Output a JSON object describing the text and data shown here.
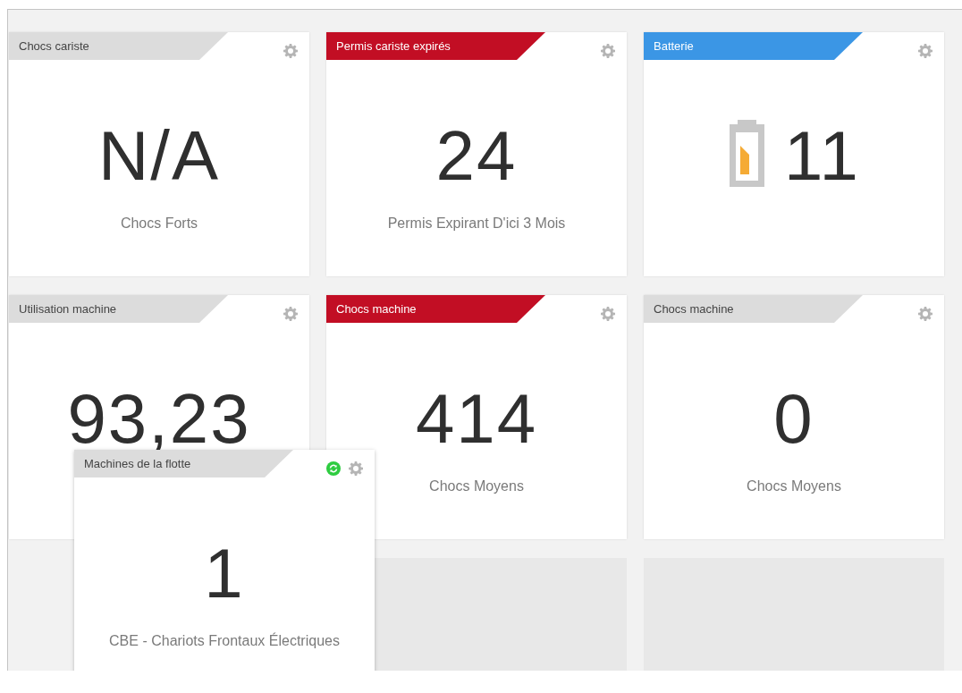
{
  "tiles": [
    {
      "kind": "stat",
      "title": "Chocs cariste",
      "color": "#dcdcdc",
      "value": "N/A",
      "caption": "Chocs Forts"
    },
    {
      "kind": "stat",
      "title": "Permis cariste expirés",
      "color": "#c20e24",
      "value": "24",
      "caption": "Permis Expirant D'ici 3 Mois"
    },
    {
      "kind": "battery",
      "title": "Batterie",
      "color": "#3b96e5",
      "value": "11"
    },
    {
      "kind": "stat",
      "title": "Utilisation machine",
      "color": "#dcdcdc",
      "value": "93,23"
    },
    {
      "kind": "stat",
      "title": "Chocs machine",
      "color": "#c20e24",
      "value": "414",
      "caption": "Chocs Moyens"
    },
    {
      "kind": "stat",
      "title": "Chocs machine",
      "color": "#dcdcdc",
      "value": "0",
      "caption": "Chocs Moyens"
    },
    {
      "kind": "empty"
    },
    {
      "kind": "placeholder"
    },
    {
      "kind": "placeholder"
    }
  ],
  "floating_tile": {
    "kind": "stat",
    "title": "Machines de la flotte",
    "color": "#dcdcdc",
    "refresh": true,
    "value": "1",
    "caption": "CBE - Chariots Frontaux Électriques"
  }
}
